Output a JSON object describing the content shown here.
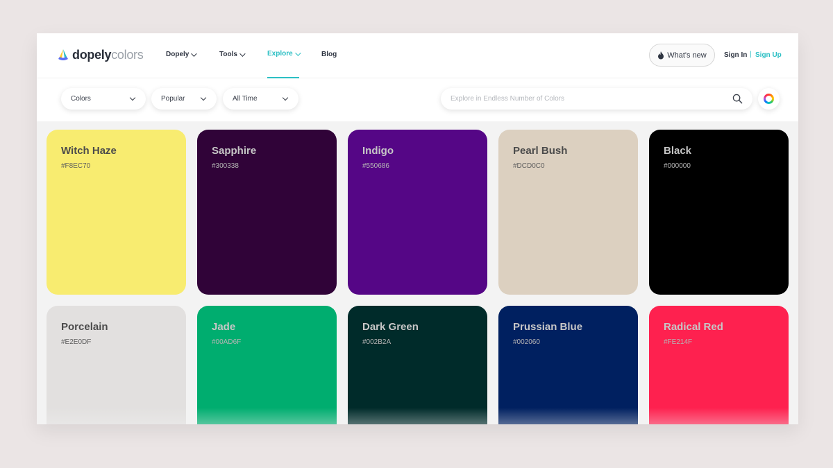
{
  "header": {
    "logo": {
      "word1": "dopely",
      "word2": "colors"
    },
    "nav": [
      {
        "label": "Dopely",
        "has_dropdown": true
      },
      {
        "label": "Tools",
        "has_dropdown": true
      },
      {
        "label": "Explore",
        "has_dropdown": true,
        "active": true
      },
      {
        "label": "Blog",
        "has_dropdown": false
      }
    ],
    "whats_new_label": "What's new",
    "whats_new_icon": "fire-icon",
    "sign_in_label": "Sign In",
    "separator": "|",
    "sign_up_label": "Sign Up"
  },
  "filters": {
    "type": "Colors",
    "sort": "Popular",
    "time": "All Time"
  },
  "search": {
    "placeholder": "Explore in Endless Number of Colors",
    "icon": "search-icon"
  },
  "color_wheel_icon": "color-wheel-icon",
  "accent_color": "#2CBFC4",
  "colors": [
    {
      "name": "Witch Haze",
      "hex": "#F8EC70",
      "tone": "light"
    },
    {
      "name": "Sapphire",
      "hex": "#300338",
      "tone": "dark"
    },
    {
      "name": "Indigo",
      "hex": "#550686",
      "tone": "dark"
    },
    {
      "name": "Pearl Bush",
      "hex": "#DCD0C0",
      "tone": "light"
    },
    {
      "name": "Black",
      "hex": "#000000",
      "tone": "dark"
    },
    {
      "name": "Porcelain",
      "hex": "#E2E0DF",
      "tone": "light"
    },
    {
      "name": "Jade",
      "hex": "#00AD6F",
      "tone": "dark"
    },
    {
      "name": "Dark Green",
      "hex": "#002B2A",
      "tone": "dark"
    },
    {
      "name": "Prussian Blue",
      "hex": "#002060",
      "tone": "dark"
    },
    {
      "name": "Radical Red",
      "hex": "#FE214F",
      "tone": "dark"
    }
  ]
}
